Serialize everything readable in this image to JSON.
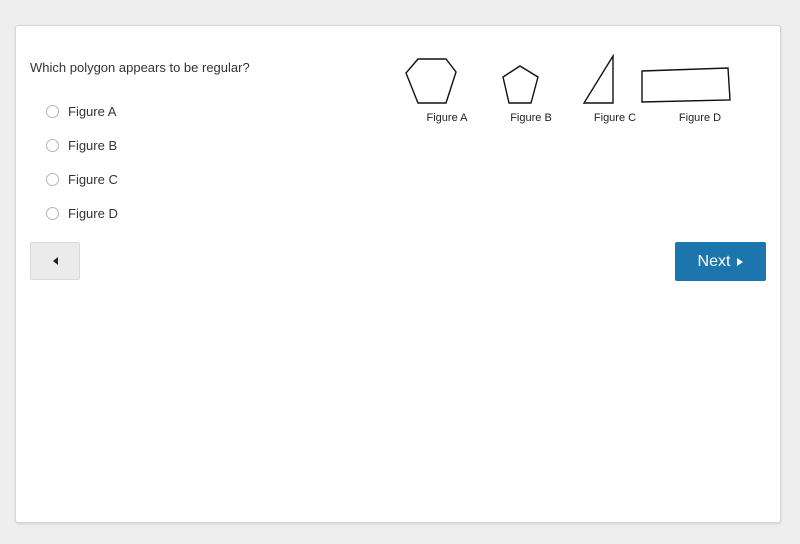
{
  "question": {
    "prompt": "Which polygon appears to be regular?",
    "options": [
      {
        "label": "Figure A",
        "selected": false
      },
      {
        "label": "Figure B",
        "selected": false
      },
      {
        "label": "Figure C",
        "selected": false
      },
      {
        "label": "Figure D",
        "selected": false
      }
    ]
  },
  "figures": [
    {
      "label": "Figure A",
      "shape": "hexagon"
    },
    {
      "label": "Figure B",
      "shape": "pentagon"
    },
    {
      "label": "Figure C",
      "shape": "right-triangle"
    },
    {
      "label": "Figure D",
      "shape": "quadrilateral"
    }
  ],
  "navigation": {
    "prev_icon": "triangle-left-icon",
    "next_label": "Next",
    "next_icon": "triangle-right-icon"
  },
  "colors": {
    "accent": "#1c75ad",
    "background": "#eeeeee"
  }
}
